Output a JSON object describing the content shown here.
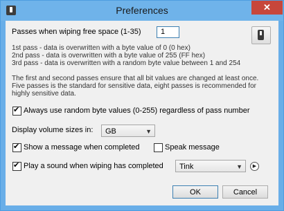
{
  "window": {
    "title": "Preferences",
    "close_glyph": "✕"
  },
  "passes": {
    "label": "Passes when wiping free space (1-35)",
    "value": "1",
    "desc": [
      "1st pass - data is overwritten with a byte value of 0 (0 hex)",
      "2nd pass - data is overwritten with a byte value of 255 (FF hex)",
      "3rd pass - data is overwritten with a random byte value between 1 and 254"
    ],
    "note": [
      "The first and second passes ensure that all bit values are changed at least once.",
      "Five passes is the standard for sensitive data, eight passes is recommended for",
      "highly sensitive data."
    ]
  },
  "options": {
    "random_bytes": {
      "label": "Always use random byte values (0-255) regardless of pass number",
      "checked": true
    },
    "volume_sizes": {
      "label": "Display volume sizes in:",
      "value": "GB"
    },
    "show_message": {
      "label": "Show a message when completed",
      "checked": true
    },
    "speak_message": {
      "label": "Speak message",
      "checked": false
    },
    "play_sound": {
      "label": "Play a sound when wiping has completed",
      "checked": true,
      "sound": "Tink"
    }
  },
  "buttons": {
    "ok": "OK",
    "cancel": "Cancel"
  },
  "icons": {
    "app": "app-toggle-icon",
    "toggle": "toggle-switch-icon",
    "play": "play-icon"
  },
  "colors": {
    "titlebar": "#6fb3ea",
    "close": "#c7463b",
    "client": "#f0f0f0"
  }
}
